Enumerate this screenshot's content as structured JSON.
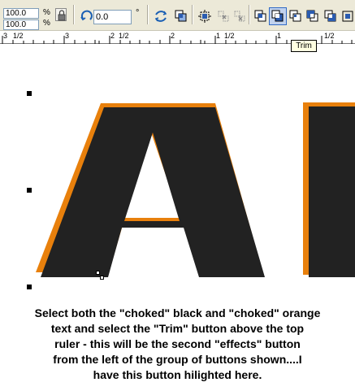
{
  "property_bar": {
    "scale_x": "100.0",
    "scale_y": "100.0",
    "percent_x": "%",
    "percent_y": "%",
    "rotation_angle": "0.0",
    "degree_symbol": "°",
    "icons": [
      "lock-ratio-icon",
      "rotation-icon",
      "mirror-icon",
      "order-icon",
      "align-icon",
      "weld-icon",
      "intersect-icon",
      "combine-icon",
      "trim-icon",
      "simplify-icon",
      "front-minus-back-icon",
      "back-minus-front-icon",
      "boundary-icon"
    ],
    "active_button": "trim-button"
  },
  "ruler": {
    "labels": [
      "3",
      "1/2",
      "3",
      "2",
      "1/2",
      "2",
      "1",
      "1/2",
      "1",
      "1/2"
    ]
  },
  "tooltip": {
    "text": "Trim"
  },
  "artwork": {
    "letters": "AI",
    "fill_color": "#222222",
    "shadow_color": "#e8800c"
  },
  "caption": {
    "lines": [
      "Select both the \"choked\" black and \"choked\" orange",
      "text and select the \"Trim\" button above the top",
      "ruler - this will be the second \"effects\" button",
      "from the left of the group of buttons shown....I",
      "have this button hilighted here."
    ]
  }
}
